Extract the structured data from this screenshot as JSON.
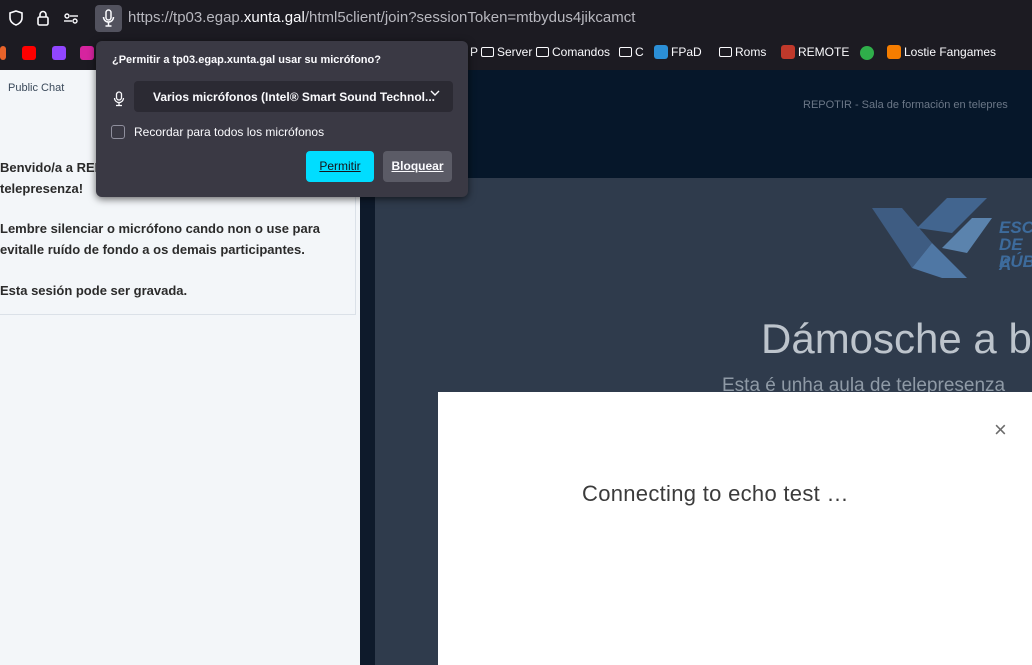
{
  "browser": {
    "url_prefix": "https://tp03.egap.",
    "url_domain": "xunta.gal",
    "url_suffix": "/html5client/join?sessionToken=mtbydus4jikcamct"
  },
  "bookmarks": {
    "partial": "P",
    "items": [
      "Server",
      "Comandos",
      "C",
      "FPaD",
      "Roms",
      "REMOTE",
      "Lostie Fangames"
    ]
  },
  "permission_popup": {
    "title": "¿Permitir a tp03.egap.xunta.gal usar su micrófono?",
    "selected_device": "Varios micrófonos (Intel® Smart Sound Technol...",
    "remember_label": "Recordar para todos los micrófonos",
    "remember_checked": false,
    "allow_label": "Permitir",
    "block_label": "Bloquear"
  },
  "left_panel": {
    "title": "Public Chat",
    "welcome_lines": [
      "Benvido/a a REI",
      "telepresenza!",
      "Lembre silenciar o micrófono cando non o use para",
      "evitalle ruído de fondo a os demais participantes.",
      "Esta sesión pode ser gravada."
    ]
  },
  "main": {
    "session_title": "REPOTIR - Sala de formación en telepres",
    "logo_lines": [
      "ESC",
      "DE A",
      "PÚB"
    ],
    "welcome_heading": "Dámosche a b",
    "welcome_subheading": "Esta é unha aula de telepresenza"
  },
  "echo_modal": {
    "message": "Connecting to echo test …",
    "close_symbol": "×"
  },
  "colors": {
    "accent_button": "#00ddff",
    "toolbar": "#1c1b22",
    "main_dark": "#06172a"
  }
}
